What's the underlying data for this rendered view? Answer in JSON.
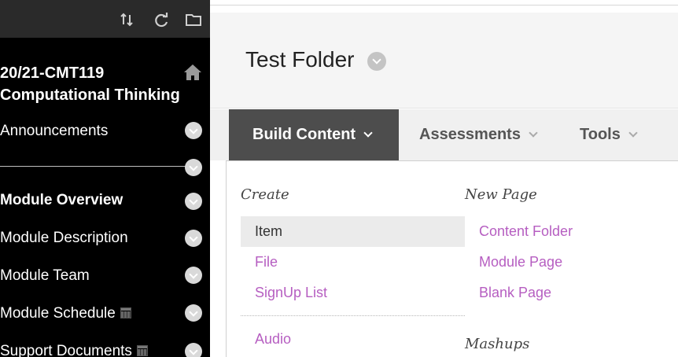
{
  "sidebar": {
    "toolbar_icons": [
      "sort-arrows-icon",
      "refresh-icon",
      "folder-icon"
    ],
    "course_title_line1": "20/21-CMT119",
    "course_title_line2": "Computational Thinking",
    "items": [
      {
        "label": "Announcements",
        "bold": false
      },
      {
        "label": "",
        "bold": false
      },
      {
        "label": "Module Overview",
        "bold": true
      },
      {
        "label": "Module Description",
        "bold": false
      },
      {
        "label": "Module Team",
        "bold": false
      },
      {
        "label": "Module Schedule",
        "bold": false
      },
      {
        "label": "Support Documents",
        "bold": false
      }
    ]
  },
  "page": {
    "title": "Test Folder"
  },
  "action_bar": {
    "build_content": "Build Content",
    "assessments": "Assessments",
    "tools": "Tools"
  },
  "menu": {
    "create_heading": "Create",
    "new_page_heading": "New Page",
    "mashups_heading": "Mashups",
    "create_items": [
      "Item",
      "File",
      "SignUp List",
      "Audio"
    ],
    "new_page_items": [
      "Content Folder",
      "Module Page",
      "Blank Page"
    ],
    "link_color": "#b65ec1"
  }
}
